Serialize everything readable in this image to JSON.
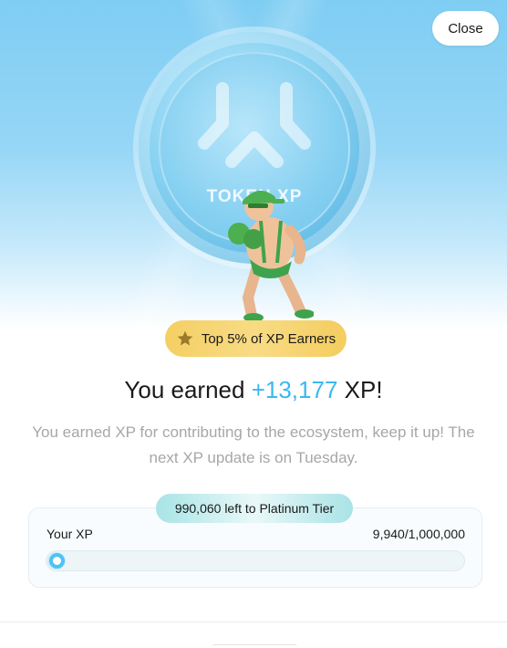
{
  "modal": {
    "close_label": "Close"
  },
  "hero": {
    "coin_text": "TOKEN XP"
  },
  "badge": {
    "icon": "star-icon",
    "label": "Top 5% of XP Earners"
  },
  "headline": {
    "prefix": "You earned",
    "xp_value": "+13,177",
    "suffix": "XP!"
  },
  "description": "You earned XP for contributing to the ecosystem, keep it up! The next XP update is on Tuesday.",
  "progress": {
    "tier_remaining": "990,060 left to Platinum Tier",
    "label": "Your XP",
    "count": "9,940/1,000,000",
    "fraction": 0.00994
  },
  "colors": {
    "accent": "#3ab8f0",
    "badge_gold": "#f4cf63",
    "mascot_green": "#4caf50"
  }
}
